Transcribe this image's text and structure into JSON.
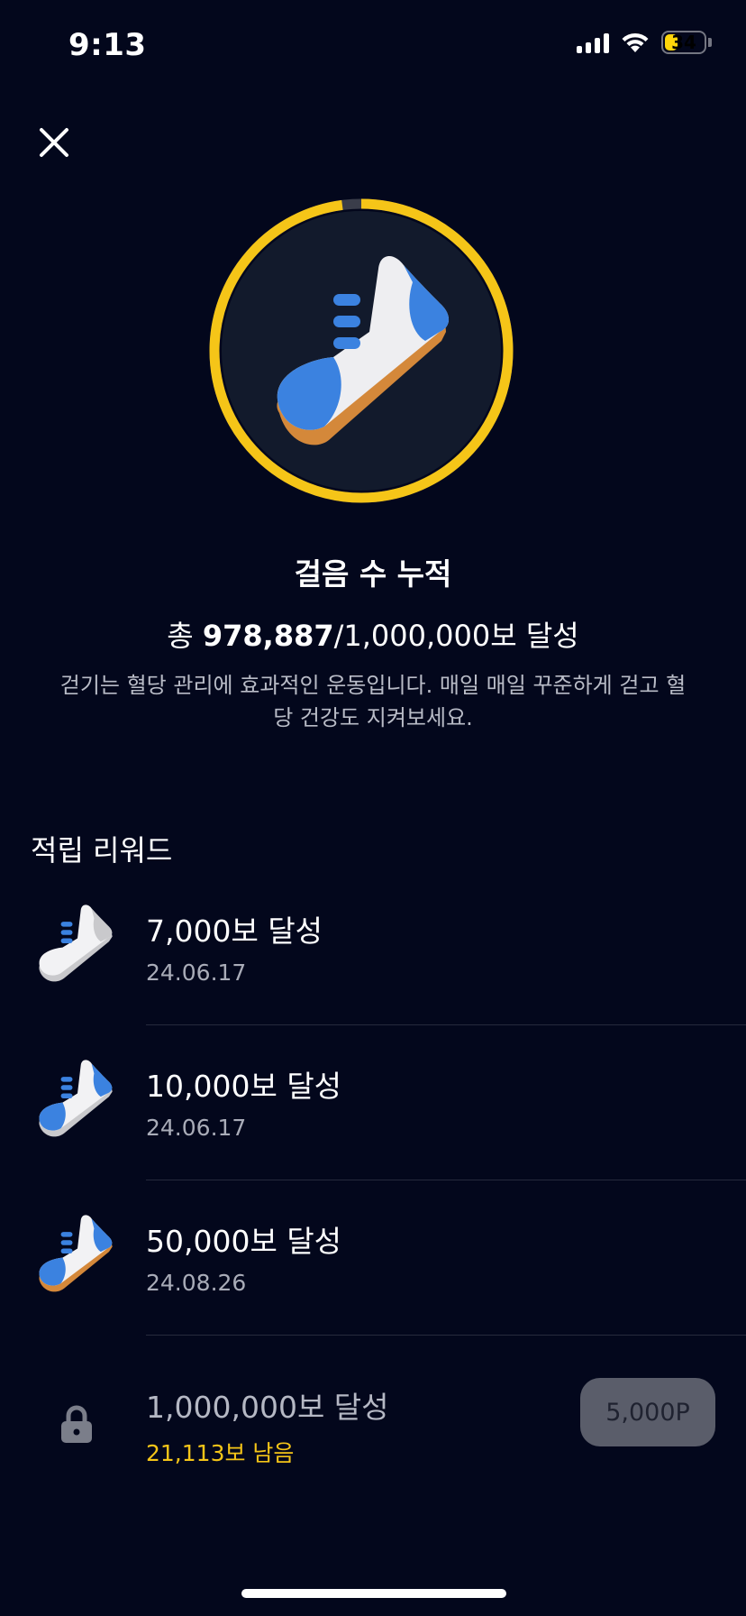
{
  "status_bar": {
    "time": "9:13",
    "battery": "34",
    "battery_level": 0.34
  },
  "header": {
    "close_icon": "close-icon"
  },
  "badge": {
    "icon": "sneaker-icon",
    "progress": 0.978887,
    "ring_color": "#f5c518"
  },
  "achievement": {
    "title": "걸음 수 누적",
    "total_prefix": "총 ",
    "total_current": "978,887",
    "total_suffix": "/1,000,000보 달성",
    "description": "걷기는 혈당 관리에 효과적인 운동입니다. 매일 매일 꾸준하게 걷고 혈당 건강도 지켜보세요."
  },
  "rewards": {
    "section_title": "적립 리워드",
    "items": [
      {
        "label": "7,000보 달성",
        "date": "24.06.17",
        "icon": "sneaker-gray-icon"
      },
      {
        "label": "10,000보 달성",
        "date": "24.06.17",
        "icon": "sneaker-blue-icon"
      },
      {
        "label": "50,000보 달성",
        "date": "24.08.26",
        "icon": "sneaker-orange-icon"
      }
    ],
    "locked": {
      "label": "1,000,000보 달성",
      "remaining": "21,113보 남음",
      "button": "5,000P",
      "icon": "lock-icon"
    }
  },
  "colors": {
    "background": "#03071c",
    "accent_yellow": "#f5c518",
    "sneaker_blue": "#3b82e0",
    "sole_orange": "#d4883a"
  }
}
